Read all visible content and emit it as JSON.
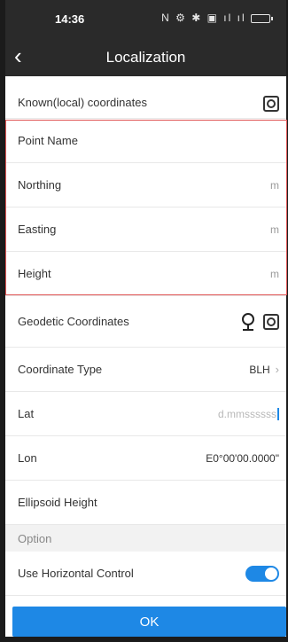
{
  "status_bar": {
    "time": "14:36",
    "icons": "N ⚙ ✱ ▣ ıl ıl"
  },
  "nav": {
    "title": "Localization",
    "back_glyph": "‹"
  },
  "known": {
    "title": "Known(local) coordinates"
  },
  "fields": {
    "point_name": "Point Name",
    "northing": "Northing",
    "easting": "Easting",
    "height": "Height",
    "unit": "m"
  },
  "geodetic": {
    "title": "Geodetic Coordinates",
    "coord_type_label": "Coordinate Type",
    "coord_type_value": "BLH",
    "lat_label": "Lat",
    "lat_placeholder": "d.mmssssss",
    "lon_label": "Lon",
    "lon_value": "E0°00'00.0000\"",
    "ellipsoid_label": "Ellipsoid Height"
  },
  "option": {
    "section": "Option",
    "use_horizontal": "Use Horizontal Control",
    "use_horizontal_on": true
  },
  "ok_button": "OK",
  "colors": {
    "accent": "#1e88e5",
    "highlight": "#e05555",
    "header": "#2a2a2a"
  }
}
